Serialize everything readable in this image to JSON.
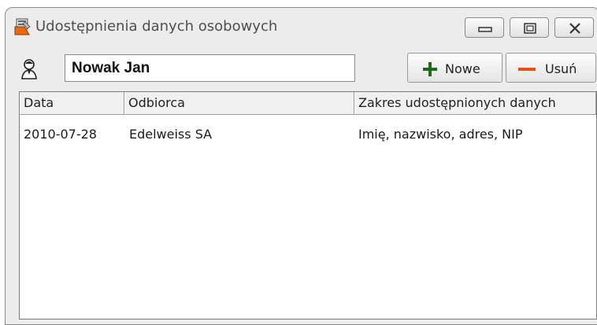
{
  "window": {
    "title": "Udostępnienia danych osobowych",
    "controls": [
      "minimize-icon",
      "maximize-icon",
      "close-icon"
    ]
  },
  "person": {
    "name": "Nowak Jan"
  },
  "toolbar": {
    "new_label": "Nowe",
    "delete_label": "Usuń",
    "new_color": "#1a6b1a",
    "delete_color": "#e8501a"
  },
  "table": {
    "columns": [
      "Data",
      "Odbiorca",
      "Zakres udostępnionych danych"
    ],
    "rows": [
      {
        "date": "2010-07-28",
        "recipient": "Edelweiss SA",
        "scope": "Imię, nazwisko, adres, NIP"
      }
    ]
  }
}
